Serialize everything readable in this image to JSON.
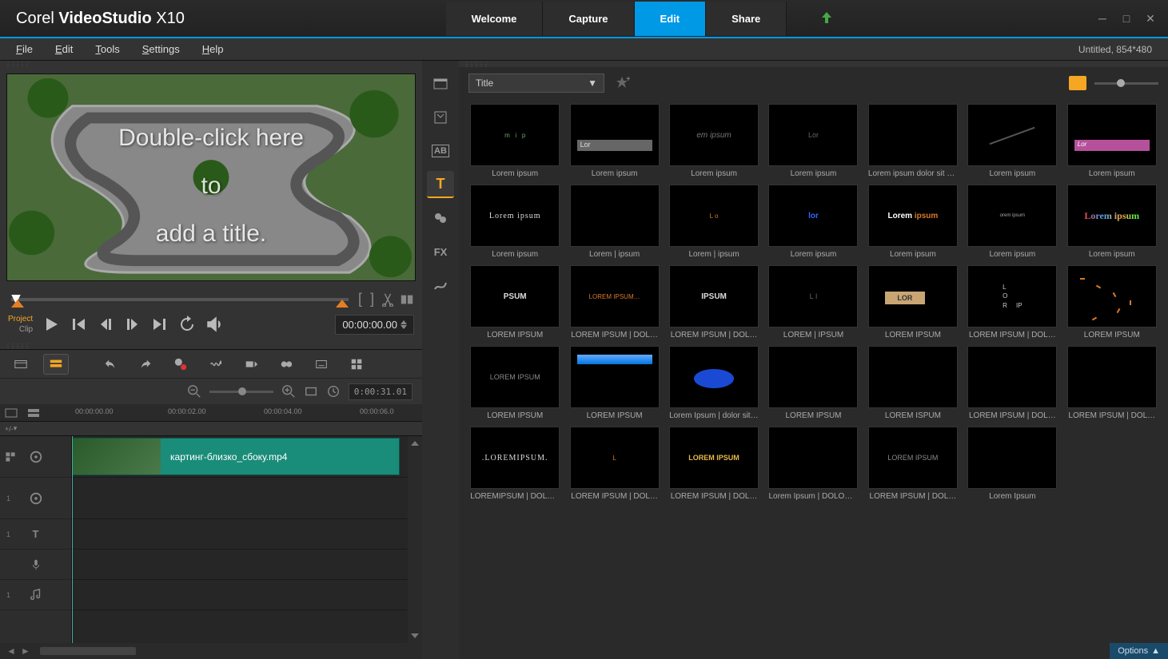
{
  "app": {
    "brand": "Corel",
    "name": "VideoStudio",
    "version": "X10"
  },
  "main_tabs": [
    "Welcome",
    "Capture",
    "Edit",
    "Share"
  ],
  "active_main_tab": "Edit",
  "menu": [
    "File",
    "Edit",
    "Tools",
    "Settings",
    "Help"
  ],
  "project_info": "Untitled, 854*480",
  "preview": {
    "title_line1": "Double-click here",
    "title_line2": "to",
    "title_line3": "add a title.",
    "mode_project": "Project",
    "mode_clip": "Clip",
    "timecode": "00:00:00.00"
  },
  "timeline": {
    "duration": "0:00:31.01",
    "ruler": [
      "00:00:00.00",
      "00:00:02.00",
      "00:00:04.00",
      "00:00:06.0"
    ],
    "clip_name": "картинг-близко_сбоку.mp4",
    "track_toggle": "+/-"
  },
  "library": {
    "dropdown": "Title",
    "items": [
      {
        "caption": "Lorem ipsum",
        "style": "dots"
      },
      {
        "caption": "Lorem ipsum",
        "style": "bar",
        "text": "Lor"
      },
      {
        "caption": "Lorem ipsum",
        "style": "italic",
        "text": "em ipsum"
      },
      {
        "caption": "Lorem ipsum",
        "style": "plain",
        "text": "Lor"
      },
      {
        "caption": "Lorem ipsum dolor sit a…",
        "style": "plain",
        "text": ""
      },
      {
        "caption": "Lorem ipsum",
        "style": "diag",
        "text": ""
      },
      {
        "caption": "Lorem ipsum",
        "style": "pinkbar",
        "text": "Lor"
      },
      {
        "caption": "Lorem ipsum",
        "style": "serif",
        "text": "Lorem ipsum"
      },
      {
        "caption": "Lorem | ipsum",
        "style": "plain",
        "text": ""
      },
      {
        "caption": "Lorem | ipsum",
        "style": "orange",
        "text": "L   o"
      },
      {
        "caption": "Lorem ipsum",
        "style": "blue",
        "text": "lor"
      },
      {
        "caption": "Lorem ipsum",
        "style": "bold",
        "text": "Lorem ipsum"
      },
      {
        "caption": "Lorem ipsum",
        "style": "tiny",
        "text": "orem ipsum"
      },
      {
        "caption": "Lorem ipsum",
        "style": "rainbow",
        "text": "Lorem ipsum"
      },
      {
        "caption": "LOREM IPSUM",
        "style": "caps",
        "text": "PSUM"
      },
      {
        "caption": "LOREM IPSUM | DOL…",
        "style": "orange",
        "text": "LOREM IPSUM…"
      },
      {
        "caption": "LOREM IPSUM | DOL…",
        "style": "caps",
        "text": "IPSUM"
      },
      {
        "caption": "LOREM | IPSUM",
        "style": "plain",
        "text": "L      I"
      },
      {
        "caption": "LOREM IPSUM",
        "style": "tanbar",
        "text": "LOR"
      },
      {
        "caption": "LOREM IPSUM | DOL…",
        "style": "column",
        "text": "L   IP"
      },
      {
        "caption": "LOREM IPSUM",
        "style": "scatter",
        "text": ""
      },
      {
        "caption": "LOREM IPSUM",
        "style": "gray",
        "text": "LOREM IPSUM"
      },
      {
        "caption": "LOREM IPSUM",
        "style": "skybar",
        "text": ""
      },
      {
        "caption": "Lorem Ipsum |  dolor sit …",
        "style": "oval",
        "text": ""
      },
      {
        "caption": "LOREM IPSUM",
        "style": "plain",
        "text": ""
      },
      {
        "caption": "LOREM ISPUM",
        "style": "plain",
        "text": ""
      },
      {
        "caption": "LOREM IPSUM | DOL…",
        "style": "plain",
        "text": ""
      },
      {
        "caption": "LOREM IPSUM | DOL…",
        "style": "plain",
        "text": ""
      },
      {
        "caption": "LOREMIPSUM | DOLO…",
        "style": "serif",
        "text": ".LOREMIPSUM."
      },
      {
        "caption": "LOREM IPSUM | DOL…",
        "style": "orange",
        "text": "L"
      },
      {
        "caption": "LOREM IPSUM | DOL…",
        "style": "gold",
        "text": "LOREM IPSUM"
      },
      {
        "caption": "Lorem Ipsum | DOLOR …",
        "style": "plain",
        "text": ""
      },
      {
        "caption": "LOREM IPSUM | DOL…",
        "style": "gray",
        "text": "LOREM IPSUM"
      },
      {
        "caption": "Lorem Ipsum",
        "style": "plain",
        "text": ""
      }
    ]
  },
  "footer": {
    "options": "Options"
  }
}
